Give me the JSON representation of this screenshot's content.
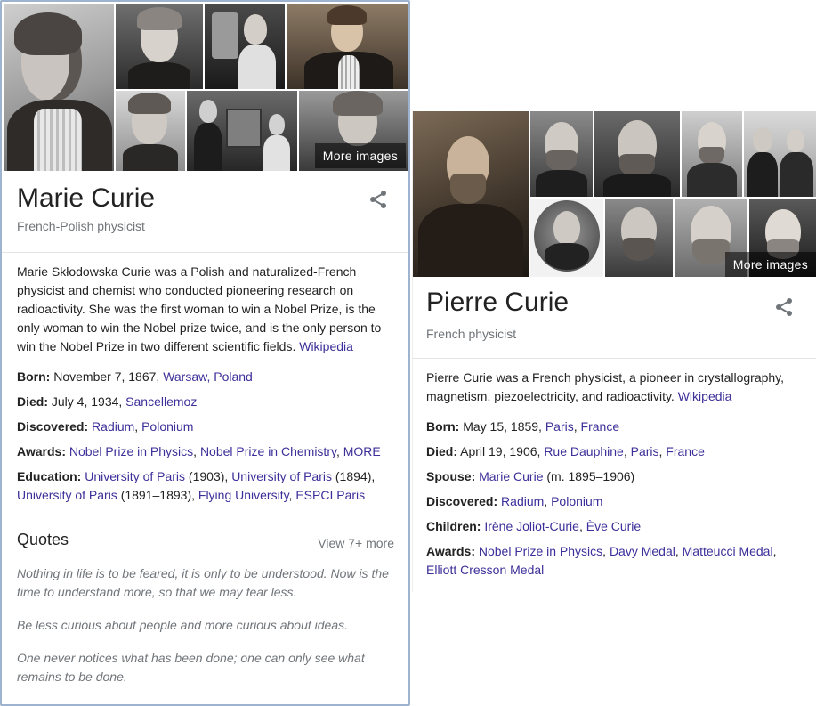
{
  "marie": {
    "gallery": {
      "more_images": "More images"
    },
    "title": "Marie Curie",
    "subtitle": "French-Polish physicist",
    "description": "Marie Skłodowska Curie was a Polish and naturalized-French physicist and chemist who conducted pioneering research on radioactivity. She was the first woman to win a Nobel Prize, is the only woman to win the Nobel prize twice, and is the only person to win the Nobel Prize in two different scientific fields.",
    "description_source": "Wikipedia",
    "born": {
      "label": "Born:",
      "text": "November 7, 1867,",
      "link": "Warsaw, Poland"
    },
    "died": {
      "label": "Died:",
      "text": "July 4, 1934,",
      "link": "Sancellemoz"
    },
    "discovered": {
      "label": "Discovered:",
      "link1": "Radium",
      "sep": ", ",
      "link2": "Polonium"
    },
    "awards": {
      "label": "Awards:",
      "link1": "Nobel Prize in Physics",
      "sep": ", ",
      "link2": "Nobel Prize in Chemistry",
      "sep2": ", ",
      "link3": "MORE"
    },
    "education": {
      "label": "Education:",
      "link1": "University of Paris",
      "text1": " (1903), ",
      "link2": "University of Paris",
      "text2": " (1894),",
      "link3": "University of Paris",
      "text3": " (1891–1893), ",
      "link4": "Flying University",
      "sep": ", ",
      "link5": "ESPCI Paris"
    },
    "quotes": {
      "heading": "Quotes",
      "view_more": "View 7+ more",
      "items": [
        "Nothing in life is to be feared, it is only to be understood. Now is the time to understand more, so that we may fear less.",
        "Be less curious about people and more curious about ideas.",
        "One never notices what has been done; one can only see what remains to be done."
      ]
    }
  },
  "pierre": {
    "gallery": {
      "more_images": "More images"
    },
    "title": "Pierre Curie",
    "subtitle": "French physicist",
    "description": "Pierre Curie was a French physicist, a pioneer in crystallography, magnetism, piezoelectricity, and radioactivity.",
    "description_source": "Wikipedia",
    "born": {
      "label": "Born:",
      "text": "May 15, 1859,",
      "link1": "Paris",
      "sep": ", ",
      "link2": "France"
    },
    "died": {
      "label": "Died:",
      "text": "April 19, 1906,",
      "link1": "Rue Dauphine",
      "sep": ", ",
      "link2": "Paris",
      "sep2": ", ",
      "link3": "France"
    },
    "spouse": {
      "label": "Spouse:",
      "link": "Marie Curie",
      "text": " (m. 1895–1906)"
    },
    "discovered": {
      "label": "Discovered:",
      "link1": "Radium",
      "sep": ", ",
      "link2": "Polonium"
    },
    "children": {
      "label": "Children:",
      "link1": "Irène Joliot-Curie",
      "sep": ", ",
      "link2": "Ève Curie"
    },
    "awards": {
      "label": "Awards:",
      "link1": "Nobel Prize in Physics",
      "sep": ", ",
      "link2": "Davy Medal",
      "sep2": ", ",
      "link3": "Matteucci Medal",
      "sep3": ",",
      "link4": "Elliott Cresson Medal"
    }
  },
  "icons": {
    "share": "share-icon"
  },
  "colors": {
    "link": "#3c2f99",
    "muted": "#70757a",
    "panel_border": "#9db3cf"
  }
}
